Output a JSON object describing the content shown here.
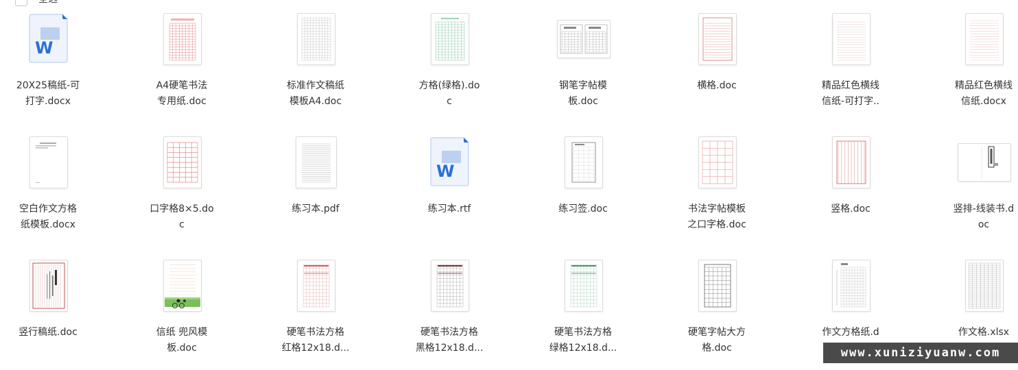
{
  "header": {
    "select_all_label": "全选"
  },
  "files": [
    {
      "name": "20X25稿纸-可打字.docx",
      "line1": "20X25稿纸-可",
      "line2": "打字.docx",
      "thumb": "word"
    },
    {
      "name": "A4硬笔书法专用纸.doc",
      "line1": "A4硬笔书法",
      "line2": "专用纸.doc",
      "thumb": "red-grid"
    },
    {
      "name": "标准作文稿纸模板A4.doc",
      "line1": "标准作文稿纸",
      "line2": "模板A4.doc",
      "thumb": "gray-grid"
    },
    {
      "name": "方格(绿格).doc",
      "line1": "方格(绿格).do",
      "line2": "c",
      "thumb": "green-grid"
    },
    {
      "name": "钢笔字帖模板.doc",
      "line1": "钢笔字帖模",
      "line2": "板.doc",
      "thumb": "landscape-2page"
    },
    {
      "name": "横格.doc",
      "line1": "横格.doc",
      "line2": "",
      "thumb": "red-horizontal"
    },
    {
      "name": "精品红色横线信纸-可打字...",
      "line1": "精品红色横线",
      "line2": "信纸-可打字..",
      "thumb": "light-horizontal"
    },
    {
      "name": "精品红色横线信纸.docx",
      "line1": "精品红色横线",
      "line2": "信纸.docx",
      "thumb": "light-horizontal-red"
    },
    {
      "name": "空白作文方格纸模板.docx",
      "line1": "空白作文方格",
      "line2": "纸模板.docx",
      "thumb": "blank-text"
    },
    {
      "name": "口字格8×5.doc",
      "line1": "口字格8×5.do",
      "line2": "c",
      "thumb": "big-red-grid"
    },
    {
      "name": "练习本.pdf",
      "line1": "练习本.pdf",
      "line2": "",
      "thumb": "gray-lines"
    },
    {
      "name": "练习本.rtf",
      "line1": "练习本.rtf",
      "line2": "",
      "thumb": "word"
    },
    {
      "name": "练习签.doc",
      "line1": "练习签.doc",
      "line2": "",
      "thumb": "dotted-grid"
    },
    {
      "name": "书法字帖模板之口字格.doc",
      "line1": "书法字帖模板",
      "line2": "之口字格.doc",
      "thumb": "big-red-grid-2"
    },
    {
      "name": "竖格.doc",
      "line1": "竖格.doc",
      "line2": "",
      "thumb": "vertical-red"
    },
    {
      "name": "竖排-线装书.doc",
      "line1": "竖排-线装书.d",
      "line2": "oc",
      "thumb": "landscape-book"
    },
    {
      "name": "竖行稿纸.doc",
      "line1": "竖行稿纸.doc",
      "line2": "",
      "thumb": "vertical-text"
    },
    {
      "name": "信纸 兜风模板.doc",
      "line1": "信纸 兜风模",
      "line2": "板.doc",
      "thumb": "letter-bike"
    },
    {
      "name": "硬笔书法方格红格12x18.d...",
      "line1": "硬笔书法方格",
      "line2": "红格12x18.d...",
      "thumb": "red-char-grid"
    },
    {
      "name": "硬笔书法方格黑格12x18.d...",
      "line1": "硬笔书法方格",
      "line2": "黑格12x18.d...",
      "thumb": "dark-char-grid"
    },
    {
      "name": "硬笔书法方格绿格12x18.d...",
      "line1": "硬笔书法方格",
      "line2": "绿格12x18.d...",
      "thumb": "green-char-grid"
    },
    {
      "name": "硬笔字帖大方格.doc",
      "line1": "硬笔字帖大方",
      "line2": "格.doc",
      "thumb": "dark-grid"
    },
    {
      "name": "作文方格纸.d",
      "line1": "作文方格纸.d",
      "line2": "",
      "thumb": "essay-grid"
    },
    {
      "name": "作文格.xlsx",
      "line1": "作文格.xlsx",
      "line2": "",
      "thumb": "xlsx-grid"
    }
  ],
  "watermark": {
    "text": "www.xuniziyuanw.com"
  },
  "colors": {
    "word_blue": "#2b6fd6",
    "red_line": "#e08a8a",
    "green_line": "#8cc9a8",
    "gray_line": "#c9c9c9"
  }
}
